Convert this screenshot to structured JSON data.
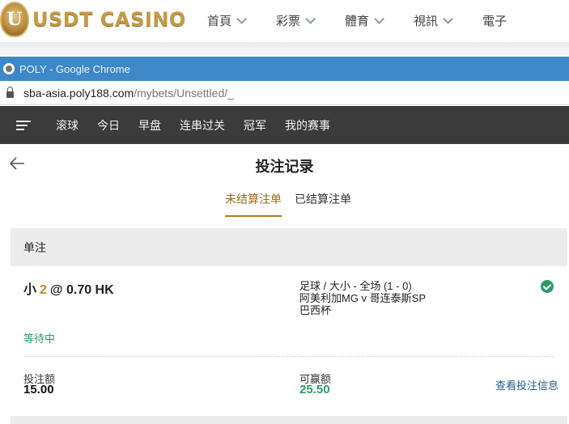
{
  "casino": {
    "logo_letter": "U",
    "logo_text": "USDT CASINO",
    "nav": [
      "首頁",
      "彩票",
      "體育",
      "視訊",
      "電子"
    ]
  },
  "chrome": {
    "title": "POLY - Google Chrome",
    "url_host": "sba-asia.poly188.com",
    "url_path": "/mybets/Unsettled/_"
  },
  "sports_nav": {
    "tabs": [
      "滚球",
      "今日",
      "早盘",
      "连串过关",
      "冠军",
      "我的赛事"
    ]
  },
  "page": {
    "title": "投注记录",
    "tabs": [
      "未结算注单",
      "已结算注单"
    ],
    "active_tab": 0
  },
  "bet": {
    "section_label": "单注",
    "selection": "小",
    "line": "2",
    "odds": "@ 0.70 HK",
    "market": "足球 / 大小 - 全场 (1 - 0)",
    "match": "阿美利加MG v 哥连泰斯SP",
    "competition": "巴西杯",
    "status": "等待中",
    "stake_label": "投注额",
    "stake_value": "15.00",
    "win_label": "可赢额",
    "win_value": "25.50",
    "info_link": "查看投注信息"
  },
  "colors": {
    "accent_gold": "#b07a24",
    "win_green": "#2e9a68",
    "chrome_blue": "#3d88c9",
    "nav_dark": "#3b3b3b"
  }
}
